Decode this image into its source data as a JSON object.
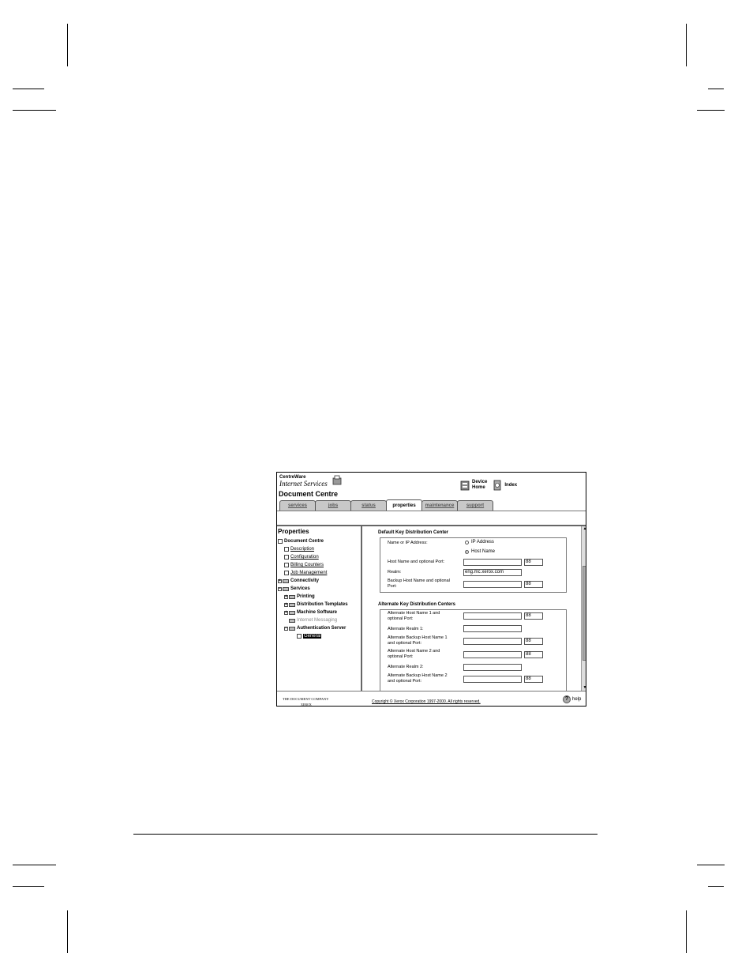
{
  "brand": {
    "line1": "CentreWare",
    "line2": "Internet Services",
    "device_title": "Document Centre"
  },
  "topnav": {
    "device_home": [
      "Device",
      "Home"
    ],
    "index": "Index"
  },
  "tabs": [
    "services",
    "jobs",
    "status",
    "properties",
    "maintenance",
    "support"
  ],
  "active_tab": "properties",
  "left": {
    "title": "Properties",
    "tree": [
      {
        "label": "Document Centre"
      },
      {
        "label": "Description"
      },
      {
        "label": "Configuration"
      },
      {
        "label": "Billing Counters"
      },
      {
        "label": "Job Management"
      },
      {
        "label": "Connectivity"
      },
      {
        "label": "Services"
      },
      {
        "label": "Printing"
      },
      {
        "label": "Distribution Templates"
      },
      {
        "label": "Machine Software"
      },
      {
        "label": "Internet Messaging"
      },
      {
        "label": "Authentication Server"
      },
      {
        "label": "General"
      }
    ]
  },
  "default_kdc": {
    "title": "Default Key Distribution Center",
    "name_or_ip_label": "Name or IP Address:",
    "radio_ip": "IP Address",
    "radio_host": "Host Name",
    "host_label": "Host Name and optional Port:",
    "host_port": "88",
    "realm_label": "Realm:",
    "realm_value": "eng.mc.xerox.com",
    "backup_label": [
      "Backup Host Name and optional",
      "Port:"
    ],
    "backup_port": "88"
  },
  "alt_kdc": {
    "title": "Alternate Key Distribution Centers",
    "rows": [
      {
        "label": [
          "Alternate Host Name 1 and",
          "optional Port:"
        ],
        "port": "88"
      },
      {
        "label": [
          "Alternate Realm 1:"
        ],
        "port": ""
      },
      {
        "label": [
          "Alternate Backup Host Name 1",
          "and optional Port:"
        ],
        "port": "88"
      },
      {
        "label": [
          "Alternate Host Name 2 and",
          "optional Port:"
        ],
        "port": "88"
      },
      {
        "label": [
          "Alternate Realm 2:"
        ],
        "port": ""
      },
      {
        "label": [
          "Alternate Backup Host Name 2",
          "and optional Port:"
        ],
        "port": "88"
      }
    ]
  },
  "footer": {
    "company": "THE DOCUMENT COMPANY",
    "xerox": "XEROX",
    "copyright": "Copyright © Xerox Corporation 1997-2000.  All rights reserved.",
    "help": "help"
  }
}
